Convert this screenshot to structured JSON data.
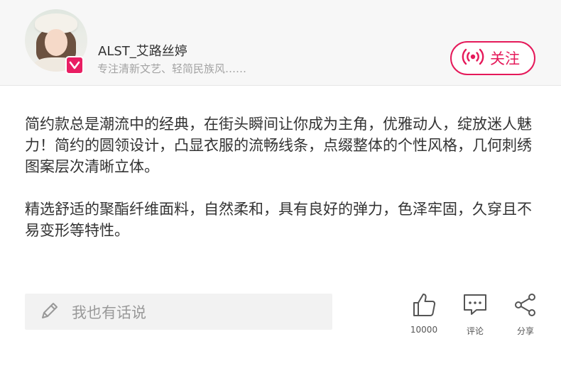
{
  "colors": {
    "accent": "#e5195a",
    "badge": "#e91e63",
    "header_bg": "#f7f7f7",
    "input_bg": "#f2f2f2",
    "muted_text": "#a3a3a3"
  },
  "header": {
    "username": "ALST_艾路丝婷",
    "bio": "专注清新文艺、轻简民族风……",
    "avatar_icon": "user-avatar",
    "badge_icon": "v-badge-icon",
    "follow_button": {
      "icon": "broadcast-icon",
      "label": "关注"
    }
  },
  "content": {
    "paragraphs": [
      "简约款总是潮流中的经典，在街头瞬间让你成为主角，优雅动人，绽放迷人魅力！简约的圆领设计，凸显衣服的流畅线条，点缀整体的个性风格，几何刺绣图案层次清晰立体。",
      "精选舒适的聚酯纤维面料，自然柔和，具有良好的弹力，色泽牢固，久穿且不易变形等特性。"
    ]
  },
  "bottom_bar": {
    "comment_input": {
      "icon": "pencil-icon",
      "placeholder": "我也有话说"
    },
    "actions": [
      {
        "icon": "thumbs-up-icon",
        "label": "10000"
      },
      {
        "icon": "comment-bubble-icon",
        "label": "评论"
      },
      {
        "icon": "share-icon",
        "label": "分享"
      }
    ]
  }
}
